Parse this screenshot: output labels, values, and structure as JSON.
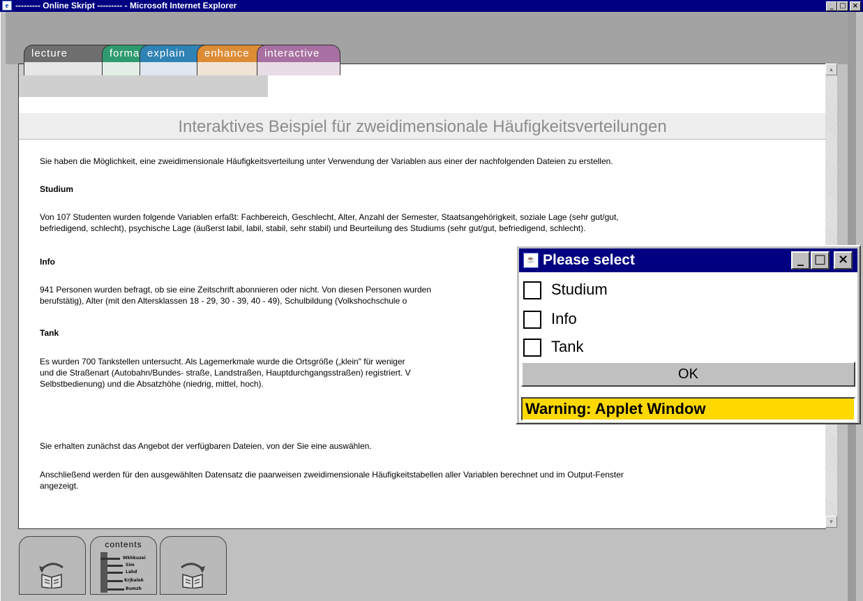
{
  "window": {
    "title": "--------- Online Skript --------- - Microsoft Internet Explorer",
    "icon": "ie-icon",
    "controls": {
      "minimize": "_",
      "maximize": "□",
      "close": "×"
    }
  },
  "tabs": [
    {
      "label": "lecture",
      "color": "#6e6e6e"
    },
    {
      "label": "format",
      "color": "#2e9a6e"
    },
    {
      "label": "explain",
      "color": "#2f82b4"
    },
    {
      "label": "enhance",
      "color": "#dd8c36"
    },
    {
      "label": "interactive",
      "color": "#a870a2"
    }
  ],
  "content": {
    "heading": "Interaktives Beispiel für zweidimensionale Häufigkeitsverteilungen",
    "intro": "Sie haben die Möglichkeit, eine zweidimensionale Häufigkeitsverteilung unter Verwendung der Variablen aus einer der nachfolgenden Dateien zu erstellen.",
    "sections": [
      {
        "title": "Studium",
        "line1": "Von 107 Studenten wurden folgende Variablen erfaßt: Fachbereich, Geschlecht, Alter, Anzahl der Semester, Staatsangehörigkeit, soziale Lage (sehr gut/gut,",
        "line2": "befriedigend, schlecht), psychische Lage (äußerst labil, labil, stabil, sehr stabil) und Beurteilung des Studiums (sehr gut/gut, befriedigend, schlecht)."
      },
      {
        "title": "Info",
        "line1": "941 Personen wurden befragt, ob sie eine Zeitschrift abonnieren oder nicht. Von diesen Personen wurden",
        "line2": "berufstätig), Alter (mit den Altersklassen 18 - 29, 30 - 39, 40 - 49), Schulbildung (Volkshochschule o"
      },
      {
        "title": "Tank",
        "line1": "Es wurden 700 Tankstellen untersucht. Als Lagemerkmale wurde die Ortsgröße („klein\" für weniger",
        "line2": "und die Straßenart (Autobahn/Bundes- straße, Landstraßen, Hauptdurchgangsstraßen) registriert. V",
        "line3": "Selbstbedienung) und die Absatzhöhe (niedrig, mittel, hoch)."
      }
    ],
    "outro1": "Sie erhalten zunächst das Angebot der verfügbaren Dateien, von der Sie eine auswählen.",
    "outro2_line1": "Anschließend werden für den ausgewählten Datensatz die paarweisen zweidimensionale Häufigkeitstabellen aller Variablen berechnet und im Output-Fenster",
    "outro2_line2": "angezeigt."
  },
  "nav": {
    "back_icon": "book-back-arrow-icon",
    "contents_label": "contents",
    "contents_tree": [
      "Wkhkuzei",
      "Sim",
      "Lahd",
      "Krjkalek",
      "Bumzh"
    ],
    "forward_icon": "book-forward-arrow-icon"
  },
  "dialog": {
    "title": "Please select",
    "icon": "java-cup-icon",
    "options": [
      {
        "label": "Studium",
        "checked": false
      },
      {
        "label": "Info",
        "checked": false
      },
      {
        "label": "Tank",
        "checked": false
      }
    ],
    "ok_label": "OK",
    "warning": "Warning: Applet Window",
    "warning_color": "#ffd800"
  }
}
